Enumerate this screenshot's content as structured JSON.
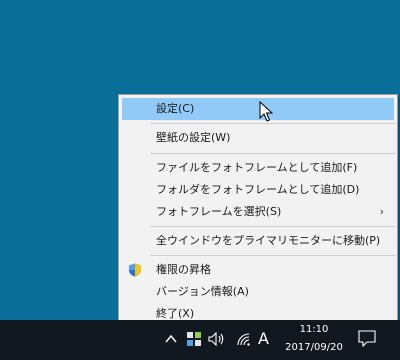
{
  "menu": {
    "items": [
      {
        "label": "設定(C)",
        "highlighted": true
      },
      {
        "label": "壁紙の設定(W)"
      },
      {
        "label": "ファイルをフォトフレームとして追加(F)"
      },
      {
        "label": "フォルダをフォトフレームとして追加(D)"
      },
      {
        "label": "フォトフレームを選択(S)",
        "submenu_arrow": "›"
      },
      {
        "label": "全ウインドウをプライマリモニターに移動(P)"
      },
      {
        "label": "権限の昇格",
        "icon": "uac-shield-icon"
      },
      {
        "label": "バージョン情報(A)"
      },
      {
        "label": "終了(X)"
      }
    ]
  },
  "taskbar": {
    "tray_chevron": "^",
    "ime_indicator": "A",
    "clock_time": "11:10",
    "clock_date": "2017/09/20"
  },
  "colors": {
    "desktop": "#0a6f98",
    "menu_bg": "#f2f2f2",
    "highlight": "#91c9f7",
    "taskbar": "#121820"
  }
}
